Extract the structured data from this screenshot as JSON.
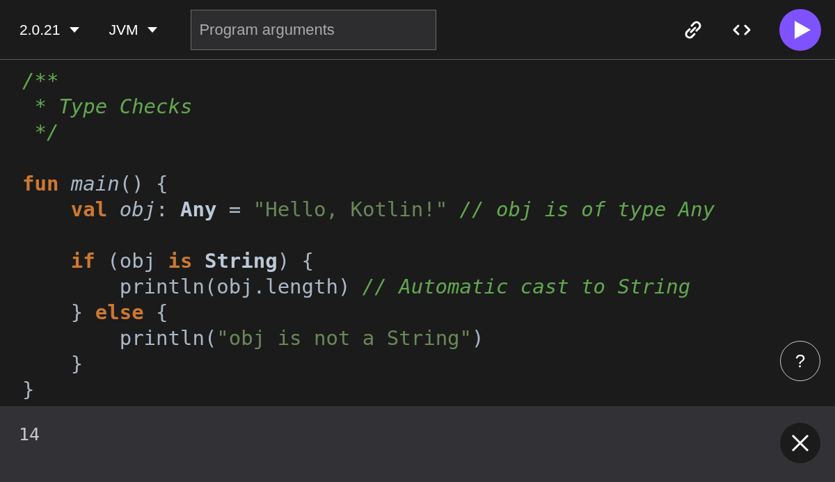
{
  "toolbar": {
    "version": {
      "label": "2.0.21"
    },
    "platform": {
      "label": "JVM"
    },
    "arguments": {
      "placeholder": "Program arguments"
    }
  },
  "code": {
    "lines": [
      {
        "tokens": [
          {
            "kind": "comment",
            "text": "/**"
          }
        ]
      },
      {
        "tokens": [
          {
            "kind": "comment",
            "text": " * Type Checks"
          }
        ]
      },
      {
        "tokens": [
          {
            "kind": "comment",
            "text": " */"
          }
        ]
      },
      {
        "gap_before": true,
        "tokens": [
          {
            "kind": "keyword",
            "text": "fun "
          },
          {
            "kind": "name",
            "text": "main"
          },
          {
            "kind": "plain",
            "text": "() {"
          }
        ]
      },
      {
        "tokens": [
          {
            "kind": "keyword",
            "text": "    val "
          },
          {
            "kind": "name",
            "text": "obj"
          },
          {
            "kind": "plain",
            "text": ": "
          },
          {
            "kind": "type",
            "text": "Any"
          },
          {
            "kind": "plain",
            "text": " = "
          },
          {
            "kind": "string",
            "text": "\"Hello, Kotlin!\""
          },
          {
            "kind": "comment",
            "text": " // obj is of type Any"
          }
        ]
      },
      {
        "gap_before": true,
        "tokens": [
          {
            "kind": "keyword",
            "text": "    if "
          },
          {
            "kind": "plain",
            "text": "(obj "
          },
          {
            "kind": "keyword",
            "text": "is "
          },
          {
            "kind": "type",
            "text": "String"
          },
          {
            "kind": "plain",
            "text": ") {"
          }
        ]
      },
      {
        "tokens": [
          {
            "kind": "plain",
            "text": "        println(obj.length)"
          },
          {
            "kind": "comment",
            "text": " // Automatic cast to String"
          }
        ]
      },
      {
        "tokens": [
          {
            "kind": "plain",
            "text": "    } "
          },
          {
            "kind": "keyword",
            "text": "else "
          },
          {
            "kind": "plain",
            "text": "{"
          }
        ]
      },
      {
        "tokens": [
          {
            "kind": "plain",
            "text": "        println("
          },
          {
            "kind": "string",
            "text": "\"obj is not a String\""
          },
          {
            "kind": "plain",
            "text": ")"
          }
        ]
      },
      {
        "tokens": [
          {
            "kind": "plain",
            "text": "    }"
          }
        ]
      },
      {
        "tokens": [
          {
            "kind": "plain",
            "text": "}"
          }
        ]
      }
    ],
    "help": {
      "label": "?"
    }
  },
  "output": {
    "text": "14"
  }
}
